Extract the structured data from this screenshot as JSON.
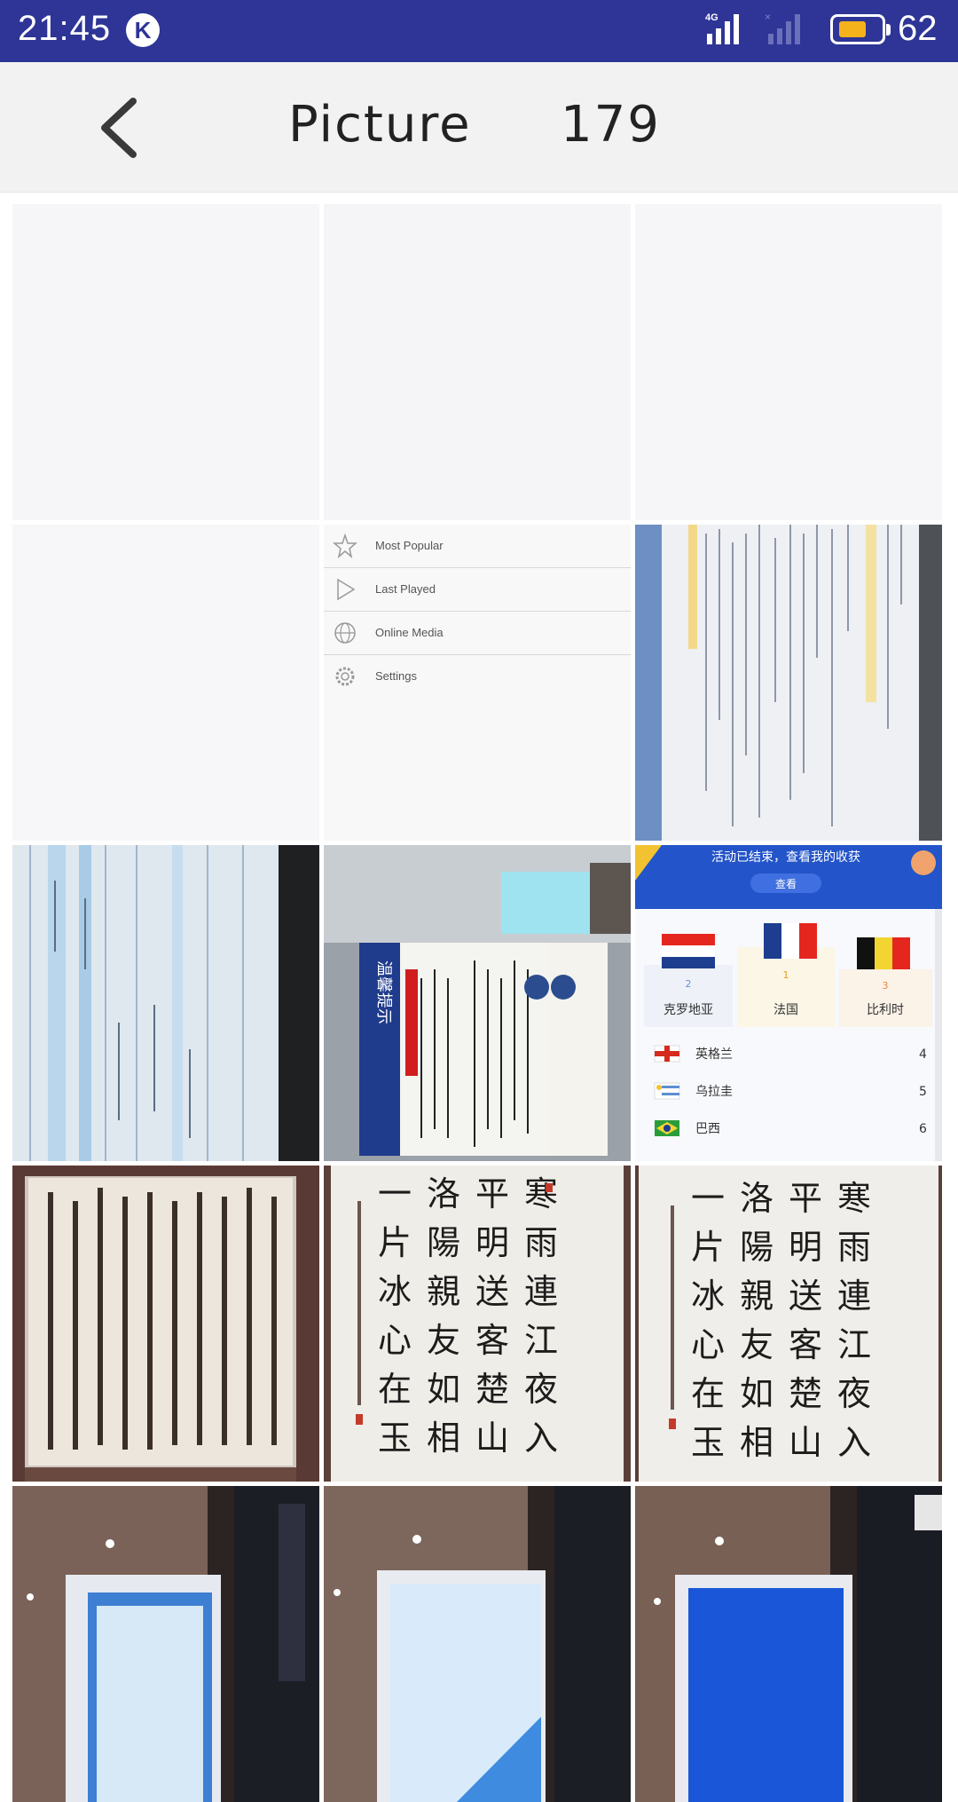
{
  "status_bar": {
    "time": "21:45",
    "k_badge": "K",
    "network": "4G",
    "battery_level": "62",
    "colors": {
      "bar": "#2e3596",
      "battery_fill": "#f6b21b"
    }
  },
  "header": {
    "back_icon": "chevron-left-icon",
    "title": "Picture",
    "count": "179"
  },
  "grid": {
    "columns": 3,
    "tiles": [
      {
        "kind": "blank"
      },
      {
        "kind": "blank"
      },
      {
        "kind": "blank"
      },
      {
        "kind": "blank"
      },
      {
        "kind": "menu-screenshot",
        "items": [
          "Most Popular",
          "Last Played",
          "Online Media",
          "Settings"
        ]
      },
      {
        "kind": "photo-code-screen"
      },
      {
        "kind": "photo-spreadsheet-screen"
      },
      {
        "kind": "photo-notice-board",
        "text": "温馨提示"
      },
      {
        "kind": "worldcup-screenshot",
        "banner": "活动已结束，查看我的收获",
        "button": "查看",
        "podium": [
          {
            "rank": "2",
            "team": "克罗地亚"
          },
          {
            "rank": "1",
            "team": "法国"
          },
          {
            "rank": "3",
            "team": "比利时"
          }
        ],
        "list": [
          {
            "team": "英格兰",
            "rank": "4"
          },
          {
            "team": "乌拉圭",
            "rank": "5"
          },
          {
            "team": "巴西",
            "rank": "6"
          }
        ]
      },
      {
        "kind": "photo-calligraphy-scroll"
      },
      {
        "kind": "photo-calligraphy-poem"
      },
      {
        "kind": "photo-calligraphy-poem"
      },
      {
        "kind": "photo-presentation"
      },
      {
        "kind": "photo-presentation"
      },
      {
        "kind": "photo-presentation"
      }
    ]
  }
}
